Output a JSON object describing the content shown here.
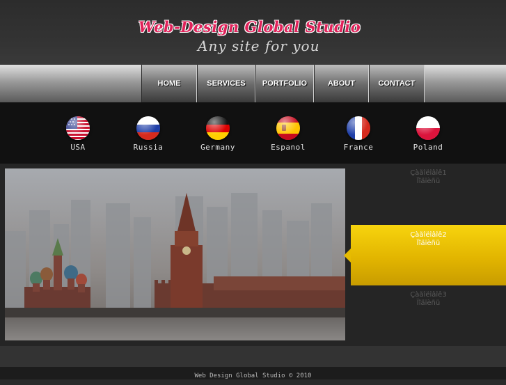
{
  "header": {
    "title": "Web-Design Global Studio",
    "tagline": "Any site for you"
  },
  "nav": {
    "items": [
      {
        "label": "HOME"
      },
      {
        "label": "SERVICES"
      },
      {
        "label": "PORTFOLIO"
      },
      {
        "label": "ABOUT"
      },
      {
        "label": "CONTACT"
      }
    ]
  },
  "languages": [
    {
      "label": "USA",
      "icon": "usa-flag-icon"
    },
    {
      "label": "Russia",
      "icon": "russia-flag-icon"
    },
    {
      "label": "Germany",
      "icon": "germany-flag-icon"
    },
    {
      "label": "Espanol",
      "icon": "spain-flag-icon"
    },
    {
      "label": "France",
      "icon": "france-flag-icon"
    },
    {
      "label": "Poland",
      "icon": "poland-flag-icon"
    }
  ],
  "slider": {
    "items": [
      {
        "line1": "Çàãîëîâîê1",
        "line2": "Ïîäïèñü",
        "active": false
      },
      {
        "line1": "Çàãîëîâîê2",
        "line2": "Ïîäïèñü",
        "active": true
      },
      {
        "line1": "Çàãîëîâîê3",
        "line2": "Ïîäïèñü",
        "active": false
      }
    ]
  },
  "footer": {
    "copyright": "Web Design Global Studio © 2010"
  },
  "colors": {
    "brand": "#e0225a",
    "accent": "#f2c800"
  }
}
